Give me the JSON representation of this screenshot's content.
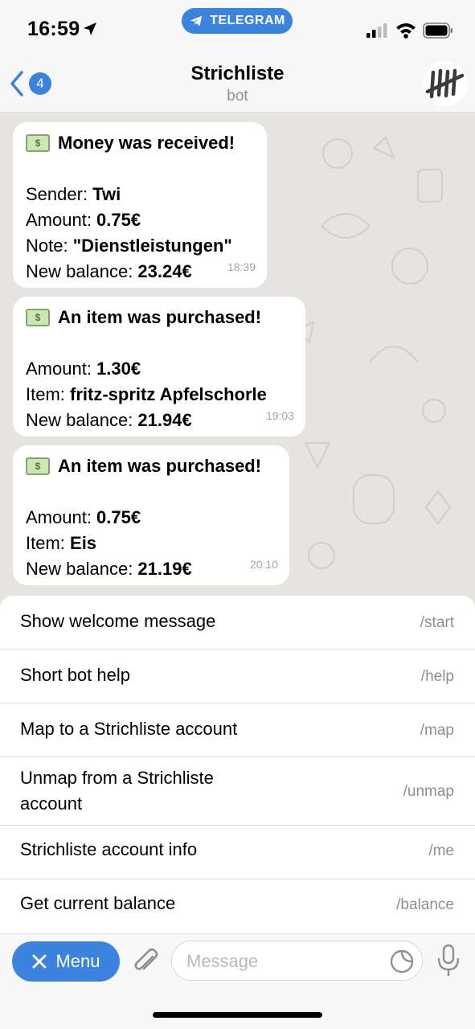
{
  "status_bar": {
    "time": "16:59",
    "pill_label": "TELEGRAM"
  },
  "header": {
    "back_count": "4",
    "title": "Strichliste",
    "subtitle": "bot"
  },
  "messages": [
    {
      "heading": "Money was received!",
      "lines": [
        {
          "label": "Sender: ",
          "value": "Twi"
        },
        {
          "label": "Amount: ",
          "value": "0.75€"
        },
        {
          "label": "Note: ",
          "value": "\"Dienstleistungen\""
        },
        {
          "label": "New balance: ",
          "value": "23.24€"
        }
      ],
      "time": "18:39"
    },
    {
      "heading": "An item was purchased!",
      "lines": [
        {
          "label": "Amount: ",
          "value": "1.30€"
        },
        {
          "label": "Item: ",
          "value": "fritz-spritz Apfelschorle"
        },
        {
          "label": "New balance: ",
          "value": "21.94€"
        }
      ],
      "time": "19:03"
    },
    {
      "heading": "An item was purchased!",
      "lines": [
        {
          "label": "Amount: ",
          "value": "0.75€"
        },
        {
          "label": "Item: ",
          "value": "Eis"
        },
        {
          "label": "New balance: ",
          "value": "21.19€"
        }
      ],
      "time": "20:10"
    }
  ],
  "commands": [
    {
      "description": "Show welcome message",
      "command": "/start"
    },
    {
      "description": "Short bot help",
      "command": "/help"
    },
    {
      "description": "Map to a Strichliste account",
      "command": "/map"
    },
    {
      "description": "Unmap from a Strichliste account",
      "command": "/unmap"
    },
    {
      "description": "Strichliste account info",
      "command": "/me"
    },
    {
      "description": "Get current balance",
      "command": "/balance"
    }
  ],
  "input_bar": {
    "menu_label": "Menu",
    "placeholder": "Message"
  },
  "colors": {
    "accent": "#3a84e0",
    "bubble": "#ffffff",
    "chat_bg": "#e6e4e1"
  },
  "icons": [
    "location-arrow-icon",
    "telegram-plane-icon",
    "signal-icon",
    "wifi-icon",
    "battery-icon",
    "chevron-left-icon",
    "tally-marks-avatar",
    "money-icon",
    "close-icon",
    "paperclip-icon",
    "sticker-icon",
    "microphone-icon"
  ]
}
